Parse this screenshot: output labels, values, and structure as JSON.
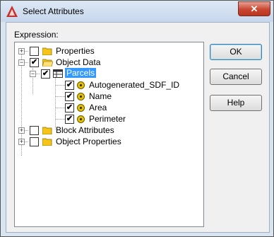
{
  "window": {
    "title": "Select Attributes",
    "close_glyph": "✕"
  },
  "expression_label": "Expression:",
  "tree": {
    "expand_plus": "+",
    "expand_minus": "−",
    "check_mark": "✔",
    "properties": "Properties",
    "object_data": "Object Data",
    "parcels": "Parcels",
    "autogenerated": "Autogenerated_SDF_ID",
    "name": "Name",
    "area": "Area",
    "perimeter": "Perimeter",
    "block_attributes": "Block Attributes",
    "object_properties": "Object Properties"
  },
  "buttons": {
    "ok": "OK",
    "cancel": "Cancel",
    "help": "Help"
  },
  "colors": {
    "selection": "#3399ff",
    "folder": "#f5c518",
    "prop_icon": "#e6c200"
  }
}
